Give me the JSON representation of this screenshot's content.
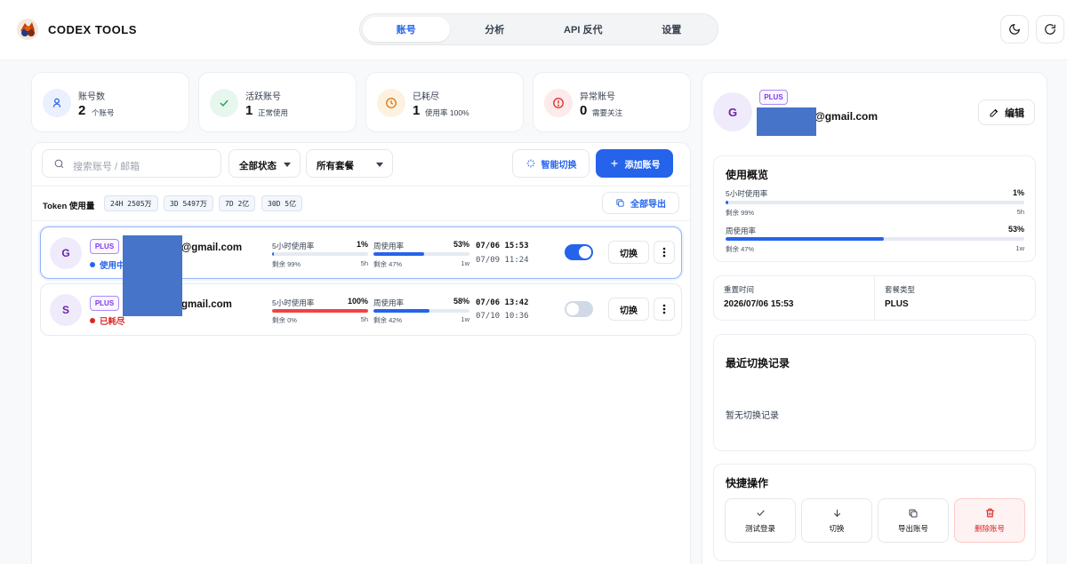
{
  "app": {
    "title": "CODEX TOOLS"
  },
  "nav": {
    "tabs": [
      {
        "label": "账号",
        "active": true
      },
      {
        "label": "分析",
        "active": false
      },
      {
        "label": "API 反代",
        "active": false
      },
      {
        "label": "设置",
        "active": false
      }
    ]
  },
  "header_actions": {
    "theme_icon": "moon-icon",
    "refresh_icon": "refresh-icon"
  },
  "stats": [
    {
      "label": "账号数",
      "value": "2",
      "sub": "个账号",
      "icon": "user-icon",
      "color": "#2563eb",
      "bg": "#eaf0fd"
    },
    {
      "label": "活跃账号",
      "value": "1",
      "sub": "正常使用",
      "icon": "check-icon",
      "color": "#16a34a",
      "bg": "#e8f7ee"
    },
    {
      "label": "已耗尽",
      "value": "1",
      "sub": "使用率 100%",
      "icon": "clock-icon",
      "color": "#d97706",
      "bg": "#fdf1e0"
    },
    {
      "label": "异常账号",
      "value": "0",
      "sub": "需要关注",
      "icon": "alert-icon",
      "color": "#dc2626",
      "bg": "#fdeaea"
    }
  ],
  "filters": {
    "search_placeholder": "搜索账号 / 邮箱",
    "status_select": "全部状态",
    "plan_select": "所有套餐",
    "smart_switch": "智能切换",
    "add_account": "添加账号"
  },
  "token_usage": {
    "label": "Token 使用量",
    "chips": [
      "24H 2505万",
      "3D 5497万",
      "7D 2亿",
      "30D 5亿"
    ],
    "export_all": "全部导出"
  },
  "accounts": [
    {
      "initial": "G",
      "plan": "PLUS",
      "email": "@gmail.com",
      "status": "使用中",
      "status_color": "#2563eb",
      "five_hour": {
        "label": "5小时使用率",
        "pct": "1%",
        "fill": 0.01,
        "remaining": "剩余 99%",
        "window": "5h",
        "color": "#2563eb"
      },
      "weekly": {
        "label": "周使用率",
        "pct": "53%",
        "fill": 0.53,
        "remaining": "剩余 47%",
        "window": "1w",
        "color": "#2563eb"
      },
      "date_primary": "07/06 15:53",
      "date_secondary": "07/09 11:24",
      "enabled": true,
      "switch_label": "切换",
      "selected": true
    },
    {
      "initial": "S",
      "plan": "PLUS",
      "email": "gmail.com",
      "status": "已耗尽",
      "status_color": "#dc2626",
      "five_hour": {
        "label": "5小时使用率",
        "pct": "100%",
        "fill": 1.0,
        "remaining": "剩余 0%",
        "window": "5h",
        "color": "#ef4444"
      },
      "weekly": {
        "label": "周使用率",
        "pct": "58%",
        "fill": 0.58,
        "remaining": "剩余 42%",
        "window": "1w",
        "color": "#2563eb"
      },
      "date_primary": "07/06 13:42",
      "date_secondary": "07/10 10:36",
      "enabled": false,
      "switch_label": "切换",
      "selected": false
    }
  ],
  "detail": {
    "initial": "G",
    "plan": "PLUS",
    "email": "@gmail.com",
    "edit_label": "编辑",
    "usage_title": "使用概览",
    "five_hour": {
      "label": "5小时使用率",
      "pct": "1%",
      "fill": 0.01,
      "remaining": "剩余 99%",
      "window": "5h"
    },
    "weekly": {
      "label": "周使用率",
      "pct": "53%",
      "fill": 0.53,
      "remaining": "剩余 47%",
      "window": "1w"
    },
    "reset_label": "重置时间",
    "reset_value": "2026/07/06 15:53",
    "plan_label": "套餐类型",
    "plan_value": "PLUS",
    "history_title": "最近切换记录",
    "history_empty": "暂无切换记录",
    "quick_title": "快捷操作",
    "quick_actions": [
      {
        "label": "测试登录",
        "icon": "check-icon"
      },
      {
        "label": "切换",
        "icon": "arrow-down-icon"
      },
      {
        "label": "导出账号",
        "icon": "copy-icon"
      },
      {
        "label": "删除账号",
        "icon": "trash-icon",
        "danger": true
      }
    ]
  }
}
